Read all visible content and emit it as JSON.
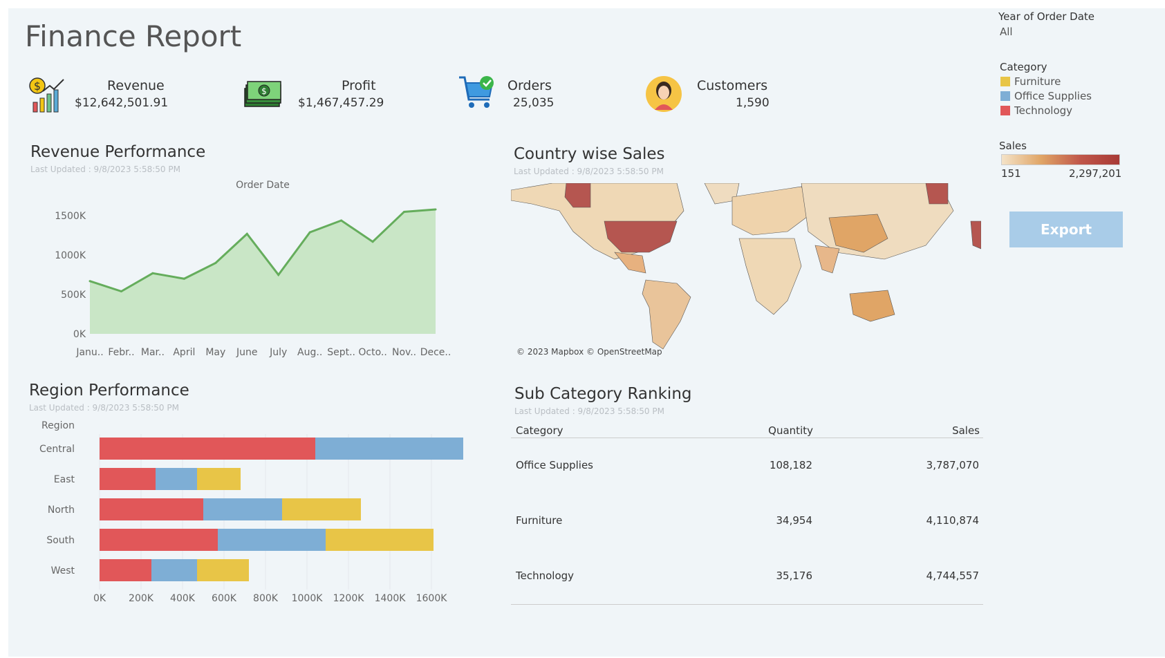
{
  "header": {
    "title": "Finance Report"
  },
  "kpis": {
    "revenue": {
      "label": "Revenue",
      "value": "$12,642,501.91",
      "icon": "revenue-chart-icon"
    },
    "profit": {
      "label": "Profit",
      "value": "$1,467,457.29",
      "icon": "money-icon"
    },
    "orders": {
      "label": "Orders",
      "value": "25,035",
      "icon": "cart-icon"
    },
    "customers": {
      "label": "Customers",
      "value": "1,590",
      "icon": "customer-avatar-icon"
    }
  },
  "filters": {
    "year_label": "Year of Order Date",
    "year_value": "All",
    "category_label": "Category",
    "categories": [
      {
        "name": "Furniture",
        "color": "#e8c547"
      },
      {
        "name": "Office Supplies",
        "color": "#7eaed5"
      },
      {
        "name": "Technology",
        "color": "#e15759"
      }
    ],
    "sales_label": "Sales",
    "sales_min": "151",
    "sales_max": "2,297,201",
    "export_label": "Export"
  },
  "revenue_section": {
    "title": "Revenue Performance",
    "updated": "Last Updated : 9/8/2023 5:58:50 PM"
  },
  "map_section": {
    "title": "Country wise Sales",
    "updated": "Last Updated : 9/8/2023 5:58:50 PM",
    "attribution": "© 2023 Mapbox © OpenStreetMap"
  },
  "region_section": {
    "title": "Region Performance",
    "updated": "Last Updated : 9/8/2023 5:58:50 PM"
  },
  "subcat_section": {
    "title": "Sub Category Ranking",
    "updated": "Last Updated : 9/8/2023 5:58:50 PM",
    "headers": [
      "Category",
      "Quantity",
      "Sales"
    ],
    "rows": [
      [
        "Office Supplies",
        "108,182",
        "3,787,070"
      ],
      [
        "Furniture",
        "34,954",
        "4,110,874"
      ],
      [
        "Technology",
        "35,176",
        "4,744,557"
      ]
    ]
  },
  "chart_data": [
    {
      "type": "area",
      "title": "Order Date",
      "categories": [
        "Janu..",
        "Febr..",
        "Mar..",
        "April",
        "May",
        "June",
        "July",
        "Aug..",
        "Sept..",
        "Octo..",
        "Nov..",
        "Dece.."
      ],
      "values": [
        670000,
        540000,
        770000,
        700000,
        900000,
        1270000,
        750000,
        1290000,
        1440000,
        1170000,
        1550000,
        1580000
      ],
      "y_ticks": [
        "0K",
        "500K",
        "1000K",
        "1500K"
      ],
      "ylim": [
        0,
        1800000
      ],
      "color": "#65ad5c",
      "fill": "#c9e6c6"
    },
    {
      "type": "bar",
      "orientation": "horizontal",
      "stacked": true,
      "ylabel": "Region",
      "categories": [
        "Central",
        "East",
        "North",
        "South",
        "West"
      ],
      "series": [
        {
          "name": "Technology",
          "color": "#e15759",
          "values": [
            1040000,
            270000,
            500000,
            570000,
            250000
          ]
        },
        {
          "name": "Office Supplies",
          "color": "#7eaed5",
          "values": [
            780000,
            200000,
            380000,
            520000,
            220000
          ]
        },
        {
          "name": "Furniture",
          "color": "#e8c547",
          "values": [
            0,
            210000,
            380000,
            520000,
            250000
          ]
        }
      ],
      "x_ticks": [
        "0K",
        "200K",
        "400K",
        "600K",
        "800K",
        "1000K",
        "1200K",
        "1400K",
        "1600K"
      ],
      "xlim": [
        0,
        1800000
      ]
    }
  ]
}
